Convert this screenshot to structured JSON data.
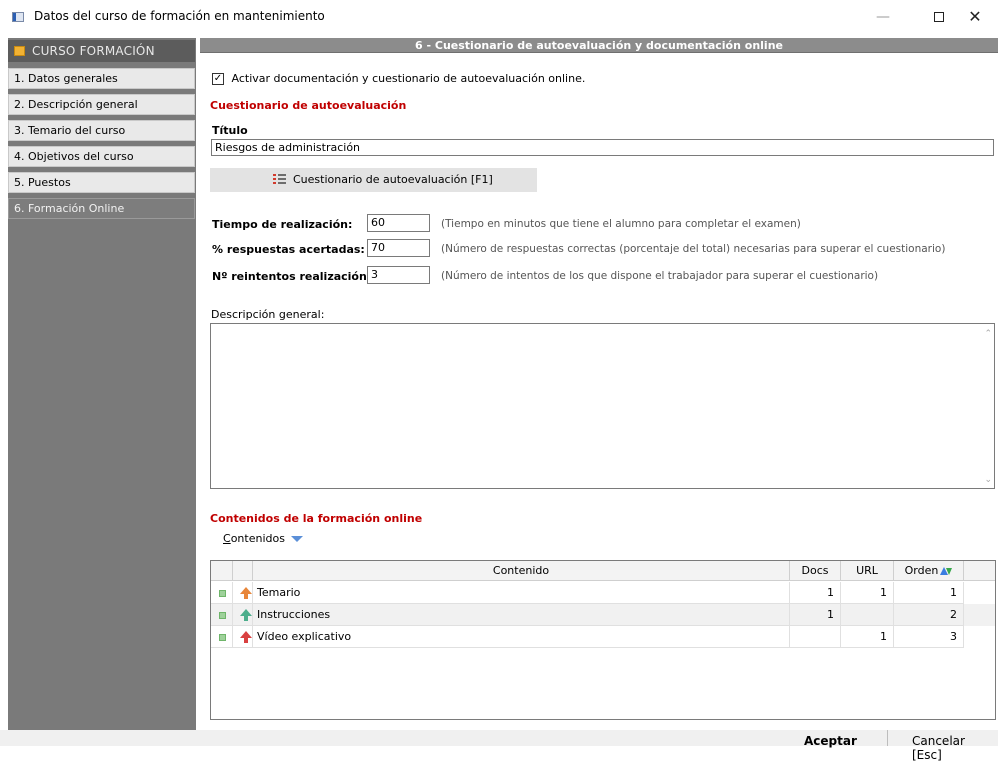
{
  "window": {
    "title": "Datos del curso de formación en mantenimiento",
    "minimize": "—",
    "close": "✕"
  },
  "sidebar": {
    "header": "CURSO FORMACIÓN",
    "items": [
      {
        "label": "1. Datos generales"
      },
      {
        "label": "2. Descripción general"
      },
      {
        "label": "3. Temario del curso"
      },
      {
        "label": "4. Objetivos del curso"
      },
      {
        "label": "5. Puestos"
      },
      {
        "label": "6. Formación Online",
        "active": true
      }
    ]
  },
  "main": {
    "header": "6 - Cuestionario de autoevaluación y documentación online",
    "activate_label": "Activar documentación y cuestionario de autoevaluación online.",
    "activate_checked": "✓",
    "quiz_section": "Cuestionario de autoevaluación",
    "titulo_label": "Título",
    "titulo_value": "Riesgos de administración",
    "quiz_button": "Cuestionario de autoevaluación  [F1]",
    "fields": [
      {
        "label": "Tiempo de realización:",
        "value": "60",
        "hint": "(Tiempo en minutos que tiene el alumno para completar el examen)"
      },
      {
        "label": "% respuestas acertadas:",
        "value": "70",
        "hint": "(Número de respuestas correctas (porcentaje del total) necesarias para superar el cuestionario)"
      },
      {
        "label": "Nº reintentos realización:",
        "value": "3",
        "hint": "(Número de intentos de los que dispone el trabajador para superar el cuestionario)"
      }
    ],
    "desc_label": "Descripción general:",
    "desc_value": "",
    "contents_section": "Contenidos de la formación online",
    "contenidos_first": "C",
    "contenidos_rest": "ontenidos"
  },
  "table": {
    "columns": [
      "Contenido",
      "Docs",
      "URL",
      "Orden"
    ],
    "rows": [
      {
        "name": "Temario",
        "docs": "1",
        "url": "1",
        "orden": "1",
        "arrow_color": "#e8863a"
      },
      {
        "name": "Instrucciones",
        "docs": "1",
        "url": "",
        "orden": "2",
        "arrow_color": "#4cae8c"
      },
      {
        "name": "Vídeo explicativo",
        "docs": "",
        "url": "1",
        "orden": "3",
        "arrow_color": "#d94040"
      }
    ]
  },
  "footer": {
    "ok": "Aceptar",
    "cancel": "Cancelar [Esc]"
  }
}
